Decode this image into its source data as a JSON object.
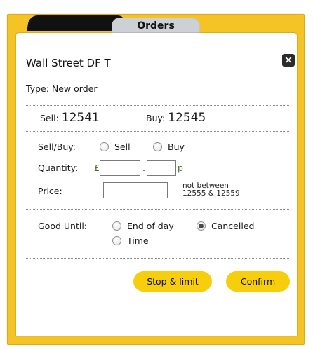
{
  "tabs": [
    {
      "label": ""
    },
    {
      "label": "Orders"
    }
  ],
  "dialog": {
    "title": "Wall Street DF T",
    "close_glyph": "✕",
    "type_text": "Type: New order"
  },
  "prices": {
    "sell_label": "Sell:",
    "sell_value": "12541",
    "buy_label": "Buy:",
    "buy_value": "12545"
  },
  "form": {
    "sellbuy_label": "Sell/Buy:",
    "sell_option": "Sell",
    "buy_option": "Buy",
    "quantity_label": "Quantity:",
    "pound_symbol": "£",
    "decimal_point": ".",
    "pence_symbol": "p",
    "quantity_pounds_value": "",
    "quantity_pence_value": "",
    "price_label": "Price:",
    "price_value": "",
    "price_note_line1": "not between",
    "price_note_line2": "12555 & 12559",
    "good_until_label": "Good Until:",
    "end_of_day_option": "End of day",
    "cancelled_option": "Cancelled",
    "time_option": "Time",
    "good_until_selected": "Cancelled"
  },
  "buttons": {
    "stop_limit_label": "Stop & limit",
    "confirm_label": "Confirm"
  },
  "colors": {
    "frame": "#f4c426",
    "button": "#f7ce0c",
    "tab_active": "#ccd1d5",
    "tab_inactive": "#111111"
  }
}
